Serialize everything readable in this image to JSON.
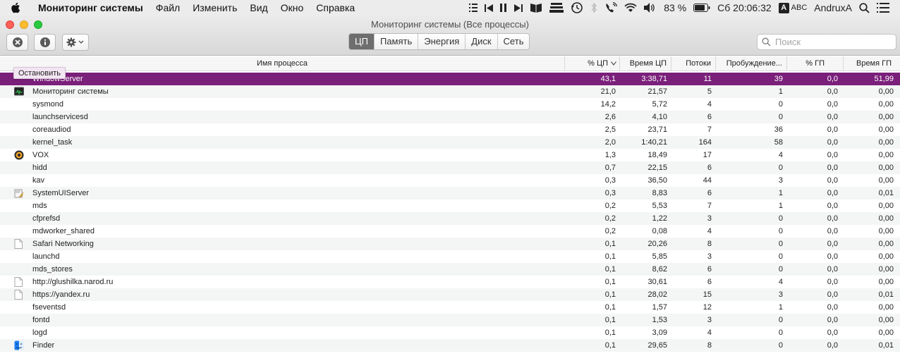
{
  "menubar": {
    "app_name": "Мониторинг системы",
    "items": [
      "Файл",
      "Изменить",
      "Вид",
      "Окно",
      "Справка"
    ],
    "battery": "83 %",
    "clock": "Сб 20:06:32",
    "input_box": "A",
    "input_text": "ABC",
    "user": "AndruxA"
  },
  "window": {
    "title": "Мониторинг системы (Все процессы)"
  },
  "tabs": [
    "ЦП",
    "Память",
    "Энергия",
    "Диск",
    "Сеть"
  ],
  "active_tab": "ЦП",
  "search": {
    "placeholder": "Поиск",
    "value": ""
  },
  "tooltip": "Остановить",
  "columns": [
    "Имя процесса",
    "% ЦП",
    "Время ЦП",
    "Потоки",
    "Пробуждение...",
    "% ГП",
    "Время ГП"
  ],
  "colors": {
    "selection": "#7a1f7a",
    "active_tab": "#6e6e6e"
  },
  "processes": [
    {
      "icon": "",
      "name": "WindowServer",
      "cpu": "43,1",
      "cpu_time": "3:38,71",
      "threads": "11",
      "wakeups": "39",
      "gpu": "0,0",
      "gpu_time": "51,99"
    },
    {
      "icon": "activity-monitor",
      "name": "Мониторинг системы",
      "cpu": "21,0",
      "cpu_time": "21,57",
      "threads": "5",
      "wakeups": "1",
      "gpu": "0,0",
      "gpu_time": "0,00"
    },
    {
      "icon": "",
      "name": "sysmond",
      "cpu": "14,2",
      "cpu_time": "5,72",
      "threads": "4",
      "wakeups": "0",
      "gpu": "0,0",
      "gpu_time": "0,00"
    },
    {
      "icon": "",
      "name": "launchservicesd",
      "cpu": "2,6",
      "cpu_time": "4,10",
      "threads": "6",
      "wakeups": "0",
      "gpu": "0,0",
      "gpu_time": "0,00"
    },
    {
      "icon": "",
      "name": "coreaudiod",
      "cpu": "2,5",
      "cpu_time": "23,71",
      "threads": "7",
      "wakeups": "36",
      "gpu": "0,0",
      "gpu_time": "0,00"
    },
    {
      "icon": "",
      "name": "kernel_task",
      "cpu": "2,0",
      "cpu_time": "1:40,21",
      "threads": "164",
      "wakeups": "58",
      "gpu": "0,0",
      "gpu_time": "0,00"
    },
    {
      "icon": "vox",
      "name": "VOX",
      "cpu": "1,3",
      "cpu_time": "18,49",
      "threads": "17",
      "wakeups": "4",
      "gpu": "0,0",
      "gpu_time": "0,00"
    },
    {
      "icon": "",
      "name": "hidd",
      "cpu": "0,7",
      "cpu_time": "22,15",
      "threads": "6",
      "wakeups": "0",
      "gpu": "0,0",
      "gpu_time": "0,00"
    },
    {
      "icon": "",
      "name": "kav",
      "cpu": "0,3",
      "cpu_time": "36,50",
      "threads": "44",
      "wakeups": "3",
      "gpu": "0,0",
      "gpu_time": "0,00"
    },
    {
      "icon": "systemuiserver",
      "name": "SystemUIServer",
      "cpu": "0,3",
      "cpu_time": "8,83",
      "threads": "6",
      "wakeups": "1",
      "gpu": "0,0",
      "gpu_time": "0,01"
    },
    {
      "icon": "",
      "name": "mds",
      "cpu": "0,2",
      "cpu_time": "5,53",
      "threads": "7",
      "wakeups": "1",
      "gpu": "0,0",
      "gpu_time": "0,00"
    },
    {
      "icon": "",
      "name": "cfprefsd",
      "cpu": "0,2",
      "cpu_time": "1,22",
      "threads": "3",
      "wakeups": "0",
      "gpu": "0,0",
      "gpu_time": "0,00"
    },
    {
      "icon": "",
      "name": "mdworker_shared",
      "cpu": "0,2",
      "cpu_time": "0,08",
      "threads": "4",
      "wakeups": "0",
      "gpu": "0,0",
      "gpu_time": "0,00"
    },
    {
      "icon": "document",
      "name": "Safari Networking",
      "cpu": "0,1",
      "cpu_time": "20,26",
      "threads": "8",
      "wakeups": "0",
      "gpu": "0,0",
      "gpu_time": "0,00"
    },
    {
      "icon": "",
      "name": "launchd",
      "cpu": "0,1",
      "cpu_time": "5,85",
      "threads": "3",
      "wakeups": "0",
      "gpu": "0,0",
      "gpu_time": "0,00"
    },
    {
      "icon": "",
      "name": "mds_stores",
      "cpu": "0,1",
      "cpu_time": "8,62",
      "threads": "6",
      "wakeups": "0",
      "gpu": "0,0",
      "gpu_time": "0,00"
    },
    {
      "icon": "document",
      "name": "http://glushilka.narod.ru",
      "cpu": "0,1",
      "cpu_time": "30,61",
      "threads": "6",
      "wakeups": "4",
      "gpu": "0,0",
      "gpu_time": "0,00"
    },
    {
      "icon": "document",
      "name": "https://yandex.ru",
      "cpu": "0,1",
      "cpu_time": "28,02",
      "threads": "15",
      "wakeups": "3",
      "gpu": "0,0",
      "gpu_time": "0,01"
    },
    {
      "icon": "",
      "name": "fseventsd",
      "cpu": "0,1",
      "cpu_time": "1,57",
      "threads": "12",
      "wakeups": "1",
      "gpu": "0,0",
      "gpu_time": "0,00"
    },
    {
      "icon": "",
      "name": "fontd",
      "cpu": "0,1",
      "cpu_time": "1,53",
      "threads": "3",
      "wakeups": "0",
      "gpu": "0,0",
      "gpu_time": "0,00"
    },
    {
      "icon": "",
      "name": "logd",
      "cpu": "0,1",
      "cpu_time": "3,09",
      "threads": "4",
      "wakeups": "0",
      "gpu": "0,0",
      "gpu_time": "0,00"
    },
    {
      "icon": "finder",
      "name": "Finder",
      "cpu": "0,1",
      "cpu_time": "29,65",
      "threads": "8",
      "wakeups": "0",
      "gpu": "0,0",
      "gpu_time": "0,01"
    }
  ]
}
